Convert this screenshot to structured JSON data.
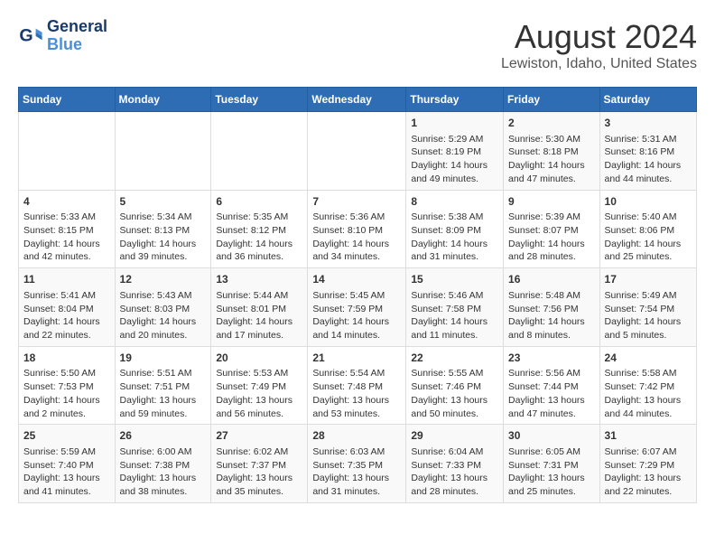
{
  "header": {
    "logo_line1": "General",
    "logo_line2": "Blue",
    "title": "August 2024",
    "subtitle": "Lewiston, Idaho, United States"
  },
  "calendar": {
    "weekdays": [
      "Sunday",
      "Monday",
      "Tuesday",
      "Wednesday",
      "Thursday",
      "Friday",
      "Saturday"
    ],
    "weeks": [
      [
        {
          "day": "",
          "info": ""
        },
        {
          "day": "",
          "info": ""
        },
        {
          "day": "",
          "info": ""
        },
        {
          "day": "",
          "info": ""
        },
        {
          "day": "1",
          "info": "Sunrise: 5:29 AM\nSunset: 8:19 PM\nDaylight: 14 hours\nand 49 minutes."
        },
        {
          "day": "2",
          "info": "Sunrise: 5:30 AM\nSunset: 8:18 PM\nDaylight: 14 hours\nand 47 minutes."
        },
        {
          "day": "3",
          "info": "Sunrise: 5:31 AM\nSunset: 8:16 PM\nDaylight: 14 hours\nand 44 minutes."
        }
      ],
      [
        {
          "day": "4",
          "info": "Sunrise: 5:33 AM\nSunset: 8:15 PM\nDaylight: 14 hours\nand 42 minutes."
        },
        {
          "day": "5",
          "info": "Sunrise: 5:34 AM\nSunset: 8:13 PM\nDaylight: 14 hours\nand 39 minutes."
        },
        {
          "day": "6",
          "info": "Sunrise: 5:35 AM\nSunset: 8:12 PM\nDaylight: 14 hours\nand 36 minutes."
        },
        {
          "day": "7",
          "info": "Sunrise: 5:36 AM\nSunset: 8:10 PM\nDaylight: 14 hours\nand 34 minutes."
        },
        {
          "day": "8",
          "info": "Sunrise: 5:38 AM\nSunset: 8:09 PM\nDaylight: 14 hours\nand 31 minutes."
        },
        {
          "day": "9",
          "info": "Sunrise: 5:39 AM\nSunset: 8:07 PM\nDaylight: 14 hours\nand 28 minutes."
        },
        {
          "day": "10",
          "info": "Sunrise: 5:40 AM\nSunset: 8:06 PM\nDaylight: 14 hours\nand 25 minutes."
        }
      ],
      [
        {
          "day": "11",
          "info": "Sunrise: 5:41 AM\nSunset: 8:04 PM\nDaylight: 14 hours\nand 22 minutes."
        },
        {
          "day": "12",
          "info": "Sunrise: 5:43 AM\nSunset: 8:03 PM\nDaylight: 14 hours\nand 20 minutes."
        },
        {
          "day": "13",
          "info": "Sunrise: 5:44 AM\nSunset: 8:01 PM\nDaylight: 14 hours\nand 17 minutes."
        },
        {
          "day": "14",
          "info": "Sunrise: 5:45 AM\nSunset: 7:59 PM\nDaylight: 14 hours\nand 14 minutes."
        },
        {
          "day": "15",
          "info": "Sunrise: 5:46 AM\nSunset: 7:58 PM\nDaylight: 14 hours\nand 11 minutes."
        },
        {
          "day": "16",
          "info": "Sunrise: 5:48 AM\nSunset: 7:56 PM\nDaylight: 14 hours\nand 8 minutes."
        },
        {
          "day": "17",
          "info": "Sunrise: 5:49 AM\nSunset: 7:54 PM\nDaylight: 14 hours\nand 5 minutes."
        }
      ],
      [
        {
          "day": "18",
          "info": "Sunrise: 5:50 AM\nSunset: 7:53 PM\nDaylight: 14 hours\nand 2 minutes."
        },
        {
          "day": "19",
          "info": "Sunrise: 5:51 AM\nSunset: 7:51 PM\nDaylight: 13 hours\nand 59 minutes."
        },
        {
          "day": "20",
          "info": "Sunrise: 5:53 AM\nSunset: 7:49 PM\nDaylight: 13 hours\nand 56 minutes."
        },
        {
          "day": "21",
          "info": "Sunrise: 5:54 AM\nSunset: 7:48 PM\nDaylight: 13 hours\nand 53 minutes."
        },
        {
          "day": "22",
          "info": "Sunrise: 5:55 AM\nSunset: 7:46 PM\nDaylight: 13 hours\nand 50 minutes."
        },
        {
          "day": "23",
          "info": "Sunrise: 5:56 AM\nSunset: 7:44 PM\nDaylight: 13 hours\nand 47 minutes."
        },
        {
          "day": "24",
          "info": "Sunrise: 5:58 AM\nSunset: 7:42 PM\nDaylight: 13 hours\nand 44 minutes."
        }
      ],
      [
        {
          "day": "25",
          "info": "Sunrise: 5:59 AM\nSunset: 7:40 PM\nDaylight: 13 hours\nand 41 minutes."
        },
        {
          "day": "26",
          "info": "Sunrise: 6:00 AM\nSunset: 7:38 PM\nDaylight: 13 hours\nand 38 minutes."
        },
        {
          "day": "27",
          "info": "Sunrise: 6:02 AM\nSunset: 7:37 PM\nDaylight: 13 hours\nand 35 minutes."
        },
        {
          "day": "28",
          "info": "Sunrise: 6:03 AM\nSunset: 7:35 PM\nDaylight: 13 hours\nand 31 minutes."
        },
        {
          "day": "29",
          "info": "Sunrise: 6:04 AM\nSunset: 7:33 PM\nDaylight: 13 hours\nand 28 minutes."
        },
        {
          "day": "30",
          "info": "Sunrise: 6:05 AM\nSunset: 7:31 PM\nDaylight: 13 hours\nand 25 minutes."
        },
        {
          "day": "31",
          "info": "Sunrise: 6:07 AM\nSunset: 7:29 PM\nDaylight: 13 hours\nand 22 minutes."
        }
      ]
    ]
  }
}
